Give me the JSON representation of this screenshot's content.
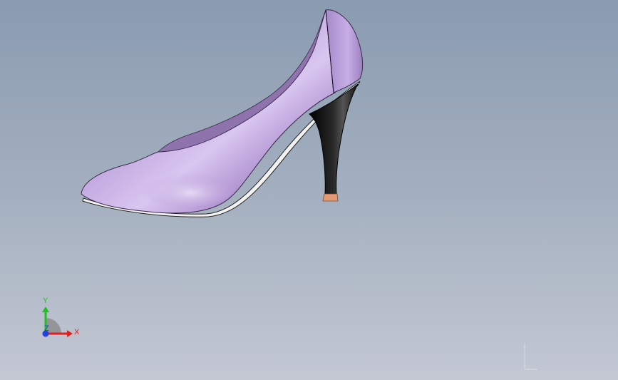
{
  "viewport": {
    "background_top": "#8a9bb0",
    "background_bottom": "#c3c8d3"
  },
  "model": {
    "name": "high-heel-shoe",
    "body_color": "#b79ad6",
    "heel_color": "#0a0a0a",
    "heel_tip_color": "#e39a74",
    "sole_color": "#f2f2f2"
  },
  "triad": {
    "x_label": "X",
    "y_label": "Y",
    "z_label": "Z",
    "x_color": "#e02020",
    "y_color": "#20c020",
    "z_color": "#2040e0"
  }
}
